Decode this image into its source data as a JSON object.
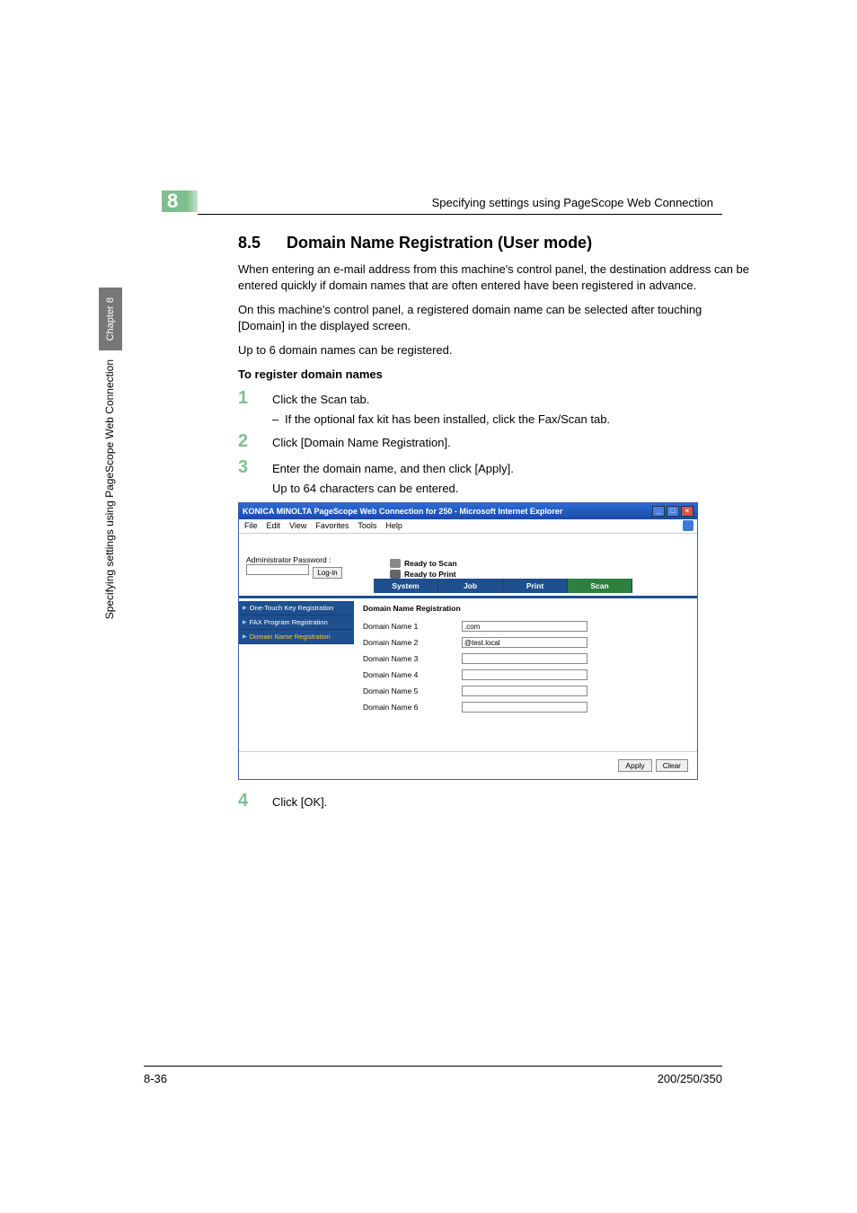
{
  "chapter": {
    "num": "8",
    "tab": "Chapter 8"
  },
  "header_right": "Specifying settings using PageScope Web Connection",
  "side_text": "Specifying settings using PageScope Web Connection",
  "section": {
    "num": "8.5",
    "title": "Domain Name Registration (User mode)"
  },
  "p1": "When entering an e-mail address from this machine's control panel, the destination address can be entered quickly if domain names that are often entered have been registered in advance.",
  "p2": "On this machine's control panel, a registered domain name can be selected after touching [Domain] in the displayed screen.",
  "p3": "Up to 6 domain names can be registered.",
  "subhead": "To register domain names",
  "steps": {
    "s1": {
      "num": "1",
      "text": "Click the Scan tab."
    },
    "s1sub": "If the optional fax kit has been installed, click the Fax/Scan tab.",
    "s2": {
      "num": "2",
      "text": "Click [Domain Name Registration]."
    },
    "s3": {
      "num": "3",
      "text": "Enter the domain name, and then click [Apply]."
    },
    "s3sub": "Up to 64 characters can be entered.",
    "s4": {
      "num": "4",
      "text": "Click [OK]."
    }
  },
  "fig": {
    "title": "KONICA MINOLTA PageScope Web Connection for 250 - Microsoft Internet Explorer",
    "menu": {
      "file": "File",
      "edit": "Edit",
      "view": "View",
      "favorites": "Favorites",
      "tools": "Tools",
      "help": "Help"
    },
    "status": {
      "scan": "Ready to Scan",
      "print": "Ready to Print"
    },
    "admin": {
      "label": "Administrator Password :",
      "login": "Log-in"
    },
    "tabs": {
      "system": "System",
      "job": "Job",
      "print": "Print",
      "scan": "Scan"
    },
    "side": {
      "i1": "One-Touch Key Registration",
      "i2": "FAX Program Registration",
      "i3": "Domain Name Registration"
    },
    "content": {
      "title": "Domain Name Registration",
      "rows": [
        {
          "label": "Domain Name 1",
          "value": ".com"
        },
        {
          "label": "Domain Name 2",
          "value": "@test.local"
        },
        {
          "label": "Domain Name 3",
          "value": ""
        },
        {
          "label": "Domain Name 4",
          "value": ""
        },
        {
          "label": "Domain Name 5",
          "value": ""
        },
        {
          "label": "Domain Name 6",
          "value": ""
        }
      ]
    },
    "buttons": {
      "apply": "Apply",
      "clear": "Clear"
    }
  },
  "footer": {
    "left": "8-36",
    "right": "200/250/350"
  }
}
